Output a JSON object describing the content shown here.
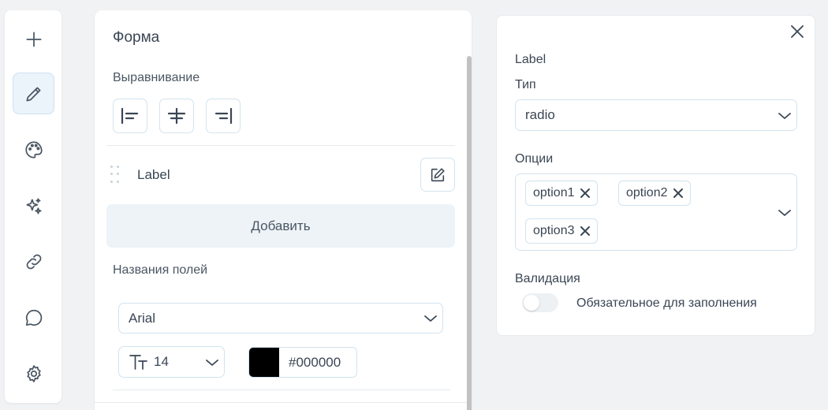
{
  "toolbar": {
    "tools": [
      {
        "icon": "plus-icon"
      },
      {
        "icon": "pencil-icon",
        "active": true
      },
      {
        "icon": "palette-icon"
      },
      {
        "icon": "sparkles-icon"
      },
      {
        "icon": "link-icon"
      },
      {
        "icon": "chat-bubble-icon"
      },
      {
        "icon": "gear-icon"
      }
    ]
  },
  "form_panel": {
    "title": "Форма",
    "alignment": {
      "label": "Выравнивание",
      "options": [
        "align-left-icon",
        "align-center-icon",
        "align-right-icon"
      ]
    },
    "field": {
      "label": "Label"
    },
    "add_button": "Добавить",
    "field_names": {
      "label": "Названия полей",
      "font_family": "Arial",
      "font_size": "14",
      "color_hex": "#000000",
      "color_swatch": "#000000"
    }
  },
  "properties_panel": {
    "field_name": "Label",
    "type": {
      "label": "Тип",
      "value": "radio"
    },
    "options": {
      "label": "Опции",
      "chips": [
        "option1",
        "option2",
        "option3"
      ]
    },
    "validation": {
      "label": "Валидация",
      "required_label": "Обязательное для заполнения",
      "required": false
    }
  },
  "colors": {
    "accent_bg": "#ebf3fb",
    "border": "#d2e3ee",
    "text": "#3a4654",
    "button_bg": "#eef3f7"
  }
}
